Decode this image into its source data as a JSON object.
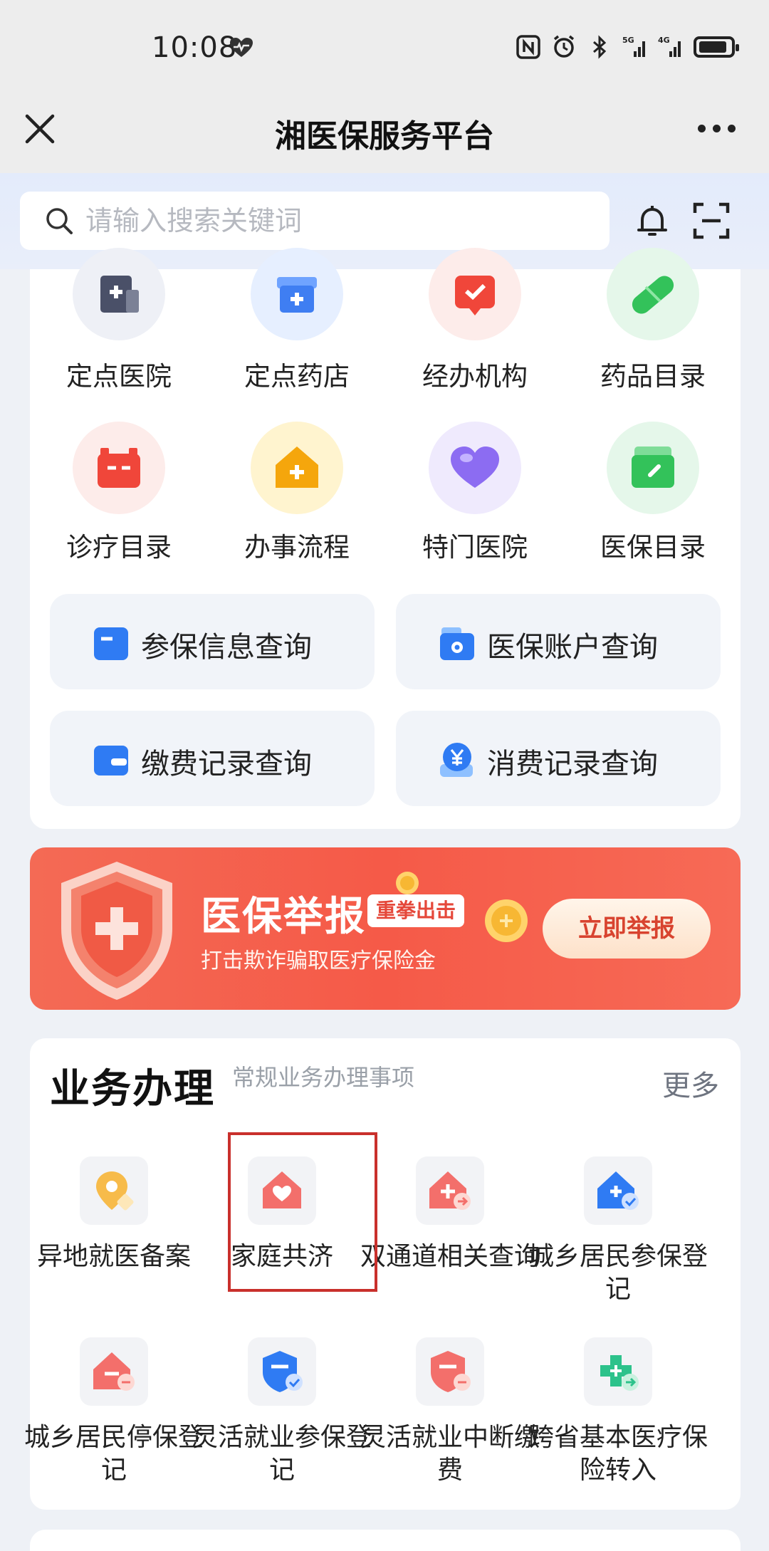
{
  "status_bar": {
    "time": "10:08"
  },
  "nav": {
    "title": "湘医保服务平台"
  },
  "search": {
    "placeholder": "请输入搜索关键词"
  },
  "services": [
    {
      "label": "定点医院",
      "icon": "hospital-icon",
      "color": "#4a5068"
    },
    {
      "label": "定点药店",
      "icon": "pharmacy-icon",
      "color": "#3f7ef2"
    },
    {
      "label": "经办机构",
      "icon": "agency-icon",
      "color": "#f0463a"
    },
    {
      "label": "药品目录",
      "icon": "pill-icon",
      "color": "#33c25a"
    },
    {
      "label": "诊疗目录",
      "icon": "medical-kit-icon",
      "color": "#f0463a"
    },
    {
      "label": "办事流程",
      "icon": "house-plus-icon",
      "color": "#f5a60c"
    },
    {
      "label": "特门医院",
      "icon": "heart-icon",
      "color": "#8c6cf2"
    },
    {
      "label": "医保目录",
      "icon": "folder-icon",
      "color": "#33c25a"
    }
  ],
  "quick": [
    {
      "label": "参保信息查询",
      "icon": "card-minus-icon"
    },
    {
      "label": "医保账户查询",
      "icon": "account-camera-icon"
    },
    {
      "label": "缴费记录查询",
      "icon": "wallet-icon"
    },
    {
      "label": "消费记录查询",
      "icon": "yuan-coin-icon"
    }
  ],
  "banner": {
    "title": "医保举报",
    "tag": "重拳出击",
    "subtitle": "打击欺诈骗取医疗保险金",
    "button": "立即举报"
  },
  "business": {
    "title": "业务办理",
    "subtitle": "常规业务办理事项",
    "more": "更多",
    "items": [
      {
        "label": "异地就医备案",
        "icon": "location-pin-icon"
      },
      {
        "label": "家庭共济",
        "icon": "house-heart-icon",
        "highlighted": true
      },
      {
        "label": "双通道相关查询",
        "icon": "house-arrow-icon"
      },
      {
        "label": "城乡居民参保登记",
        "icon": "house-check-icon"
      },
      {
        "label": "城乡居民停保登记",
        "icon": "house-minus-icon"
      },
      {
        "label": "灵活就业参保登记",
        "icon": "shield-check-icon"
      },
      {
        "label": "灵活就业中断缴费",
        "icon": "shield-minus-icon"
      },
      {
        "label": "跨省基本医疗保险转入",
        "icon": "medical-transfer-icon"
      }
    ]
  }
}
